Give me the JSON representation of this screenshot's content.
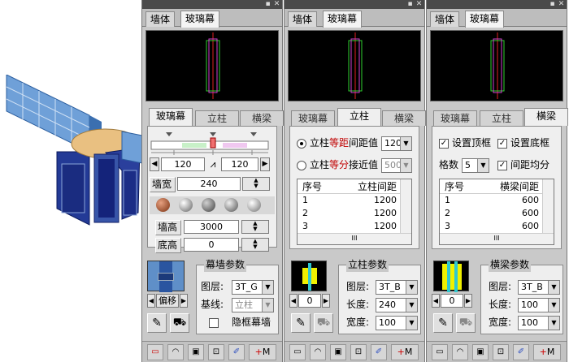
{
  "colors": {
    "panel_bg": "#c9c9c9",
    "preview_bg": "#000000",
    "accent_red": "#c00000"
  },
  "panels": [
    {
      "top_tabs": [
        "墙体",
        "玻璃幕"
      ],
      "active_top": 1,
      "sub_tabs": [
        "玻璃幕",
        "立柱",
        "横梁"
      ],
      "active_sub": 0,
      "slider": {
        "left": "120",
        "right": "120"
      },
      "wall_width_label": "墙宽",
      "wall_width": "240",
      "wall_height_label": "墙高",
      "wall_height": "3000",
      "base_height_label": "底高",
      "base_height": "0",
      "offset_label": "偏移",
      "group_title": "幕墙参数",
      "layer_label": "图层:",
      "layer_value": "3T_G",
      "baseline_label": "基线:",
      "baseline_value": "立柱",
      "hidden_frame_label": "隐框幕墙"
    },
    {
      "top_tabs": [
        "墙体",
        "玻璃幕"
      ],
      "active_top": 1,
      "sub_tabs": [
        "玻璃幕",
        "立柱",
        "横梁"
      ],
      "active_sub": 1,
      "radio1": {
        "a": "立柱",
        "b": "等距",
        "c": "间距值",
        "value": "120"
      },
      "radio2": {
        "a": "立柱",
        "b": "等分",
        "c": "接近值",
        "value": "500"
      },
      "table": {
        "col1": "序号",
        "col2": "立柱间距",
        "rows": [
          [
            "1",
            "1200"
          ],
          [
            "2",
            "1200"
          ],
          [
            "3",
            "1200"
          ]
        ]
      },
      "spin_value": "0",
      "group_title": "立柱参数",
      "layer_label": "图层:",
      "layer_value": "3T_B",
      "length_label": "长度:",
      "length_value": "240",
      "width_label": "宽度:",
      "width_value": "100"
    },
    {
      "top_tabs": [
        "墙体",
        "玻璃幕"
      ],
      "active_top": 1,
      "sub_tabs": [
        "玻璃幕",
        "立柱",
        "横梁"
      ],
      "active_sub": 2,
      "check_top": "设置顶框",
      "check_bottom": "设置底框",
      "count_label": "格数",
      "count_value": "5",
      "even_label": "间距均分",
      "table": {
        "col1": "序号",
        "col2": "横梁间距",
        "rows": [
          [
            "1",
            "600"
          ],
          [
            "2",
            "600"
          ],
          [
            "3",
            "600"
          ]
        ]
      },
      "spin_value": "0",
      "group_title": "横梁参数",
      "layer_label": "图层:",
      "layer_value": "3T_B",
      "length_label": "长度:",
      "length_value": "100",
      "width_label": "宽度:",
      "width_value": "100"
    }
  ]
}
